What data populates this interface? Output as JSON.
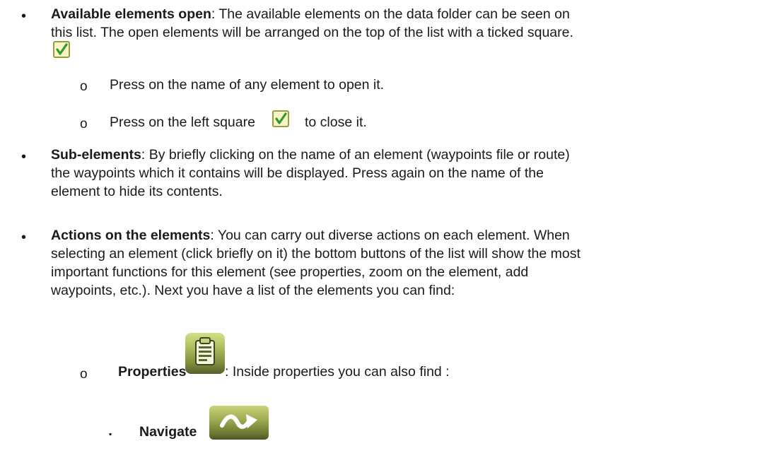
{
  "bullets": [
    {
      "title": "Available elements open",
      "line1": ": The available elements on the data folder can be seen on",
      "line2": "this list. The open elements will be arranged on the top of the list with a ticked square.",
      "icon": "checkbox-checked-icon"
    },
    {
      "title": "Sub-elements",
      "line1": ": By briefly clicking on the name of an element (waypoints file or route)",
      "line2": "the waypoints which it contains will be displayed. Press again on the name of the",
      "line3": "element to hide its contents."
    },
    {
      "title": "Actions on the elements",
      "line1": ": You can carry out diverse actions on each element. When",
      "line2": "selecting an element (click briefly on it) the bottom buttons of the list will show the most",
      "line3": "important functions for this element (see properties, zoom on the element, add",
      "line4": "waypoints, etc.). Next you have a list of the elements you can find:"
    }
  ],
  "sub_items": [
    {
      "text": "Press on the name of any element to open it."
    },
    {
      "text_before": "Press on the left square",
      "text_after": "to close it.",
      "icon": "checkbox-checked-icon"
    }
  ],
  "properties": {
    "label": "Properties",
    "icon": "clipboard-icon",
    "description": ": Inside properties you can also find :"
  },
  "navigate": {
    "label": "Navigate",
    "icon": "navigate-arrow-icon"
  },
  "markers": {
    "bullet": "•",
    "sub": "o",
    "square": "▪"
  },
  "colors": {
    "check_green": "#2e9a2a",
    "icon_olive": "#7f8a3a"
  }
}
